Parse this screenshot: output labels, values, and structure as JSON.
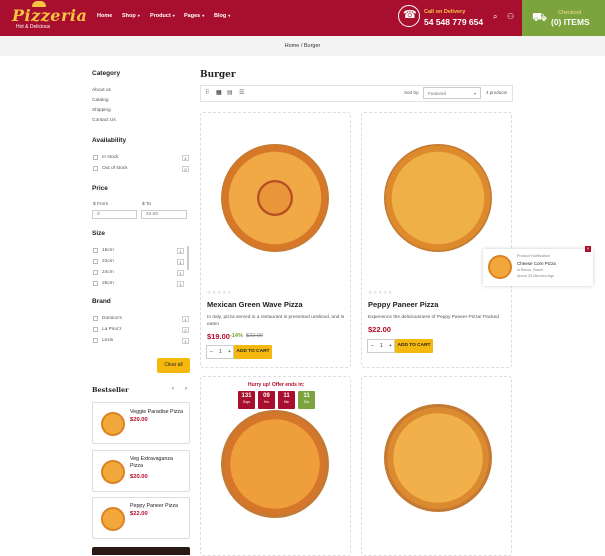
{
  "header": {
    "logo_title": "Pizzeria",
    "logo_tagline": "Hot & Delicious",
    "nav": [
      "Home",
      "Shop",
      "Product",
      "Pages",
      "Blog"
    ],
    "call_label": "Call on Delivery",
    "call_number": "54 548 779 654",
    "cart_label": "Checkout",
    "cart_items": "(0) ITEMS",
    "accent": "#a80f2e",
    "cart_color": "#7ba33e"
  },
  "breadcrumb": {
    "home": "Home",
    "sep": "/",
    "current": "Burger"
  },
  "sidebar": {
    "category_title": "Category",
    "categories": [
      "About us",
      "Catalog",
      "Shipping",
      "Contact Us"
    ],
    "availability_title": "Availability",
    "availability": [
      {
        "label": "In stock",
        "count": "4"
      },
      {
        "label": "Out of stock",
        "count": "0"
      }
    ],
    "price_title": "Price",
    "price_from_label": "$ From",
    "price_to_label": "$ To",
    "price_from": "0",
    "price_to": "33.00",
    "size_title": "Size",
    "sizes": [
      {
        "label": "15cm",
        "count": "1"
      },
      {
        "label": "22cm",
        "count": "1"
      },
      {
        "label": "24cm",
        "count": "1"
      },
      {
        "label": "25cm",
        "count": "1"
      }
    ],
    "brand_title": "Brand",
    "brands": [
      {
        "label": "Domino's",
        "count": "1"
      },
      {
        "label": "La Pino'z",
        "count": "2"
      },
      {
        "label": "Lezis",
        "count": "1"
      }
    ],
    "clear_all": "Clear all",
    "bestseller_title": "Bestseller",
    "bestsellers": [
      {
        "name": "Veggie Paradise Pizza",
        "price": "$20.00"
      },
      {
        "name": "Veg Extravaganza Pizza",
        "price": "$20.00"
      },
      {
        "name": "Peppy Paneer Pizza",
        "price": "$22.00"
      }
    ]
  },
  "main": {
    "title": "Burger",
    "sort_label": "Sort by:",
    "sort_value": "Featured",
    "product_count": "4 products",
    "add_to_cart": "ADD TO CART",
    "stars": "★★★★★",
    "qty_value": "1",
    "products": [
      {
        "name": "Mexican Green Wave Pizza",
        "desc": "In Italy, pizza served in a restaurant is presented unsliced, and is eaten",
        "price": "$19.00",
        "discount": "-14%",
        "old_price": "$22.00"
      },
      {
        "name": "Peppy Paneer Pizza",
        "desc": "Experience the deliciousness of Peppy Paneer Pizza! Packed",
        "price": "$22.00"
      }
    ],
    "countdown": {
      "label": "Hurry up! Offer ends in:",
      "units": [
        {
          "n": "131",
          "u": "Days"
        },
        {
          "n": "09",
          "u": "Hrs"
        },
        {
          "n": "11",
          "u": "Min"
        },
        {
          "n": "11",
          "u": "Sec"
        }
      ]
    }
  },
  "notification": {
    "label": "Product Notification",
    "product": "Cheese Corn Pizza",
    "location": "in Bauru, Brazil",
    "time": "About 25 Minutes Ago"
  }
}
